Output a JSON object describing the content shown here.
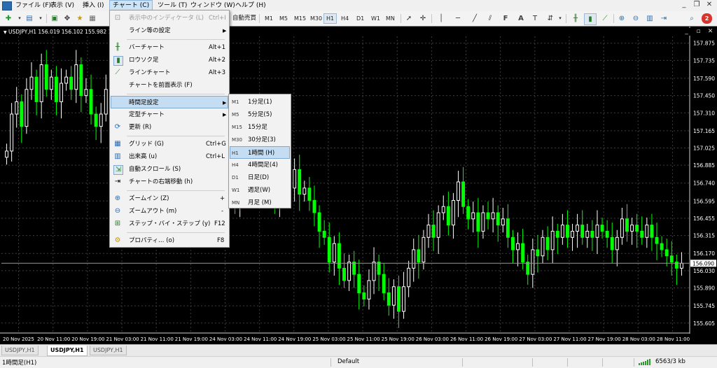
{
  "menubar": {
    "items": [
      "ファイル (F)",
      "表示 (V)",
      "挿入 (I)",
      "チャート (C)",
      "ツール (T)",
      "ウィンドウ (W)",
      "ヘルプ (H)"
    ]
  },
  "toolbar": {
    "autotrade_label": "自動売買",
    "timeframes": [
      "M1",
      "M5",
      "M15",
      "M30",
      "H1",
      "H4",
      "D1",
      "W1",
      "MN"
    ]
  },
  "chart": {
    "header": "USDJPY,H1  156.019 156.102 155.982 156.090",
    "current_price": "156.090",
    "colors": {
      "background": "#000000",
      "bull": "#ffffff",
      "bear": "#00ff00",
      "grid": "#3c3c3c"
    }
  },
  "chart_menu": {
    "items": [
      {
        "icon": "indicators-icon",
        "label": "表示中のインディケータ (L)",
        "shortcut": "Ctrl+I",
        "disabled": true
      },
      {
        "icon": "",
        "label": "ライン等の設定",
        "submenu": true
      },
      {
        "sep": true
      },
      {
        "icon": "bar-chart-icon",
        "label": "バーチャート",
        "shortcut": "Alt+1"
      },
      {
        "icon": "candlestick-icon",
        "label": "ロウソク足",
        "shortcut": "Alt+2"
      },
      {
        "icon": "line-chart-icon",
        "label": "ラインチャート",
        "shortcut": "Alt+3"
      },
      {
        "icon": "",
        "label": "チャートを前面表示 (F)"
      },
      {
        "sep": true
      },
      {
        "icon": "",
        "label": "時間足設定",
        "submenu": true,
        "highlighted": true
      },
      {
        "icon": "",
        "label": "定型チャート",
        "submenu": true
      },
      {
        "icon": "refresh-icon",
        "label": "更新 (R)"
      },
      {
        "sep": true
      },
      {
        "icon": "grid-icon",
        "label": "グリッド (G)",
        "shortcut": "Ctrl+G"
      },
      {
        "icon": "volume-icon",
        "label": "出来高 (u)",
        "shortcut": "Ctrl+L"
      },
      {
        "icon": "autoscroll-icon",
        "label": "自動スクロール (S)"
      },
      {
        "icon": "chart-shift-icon",
        "label": "チャートの右端移動 (h)"
      },
      {
        "sep": true
      },
      {
        "icon": "zoom-in-icon",
        "label": "ズームイン (Z)",
        "shortcut": "+"
      },
      {
        "icon": "zoom-out-icon",
        "label": "ズームアウト (m)",
        "shortcut": "-"
      },
      {
        "icon": "step-icon",
        "label": "ステップ・バイ・ステップ (y)",
        "shortcut": "F12"
      },
      {
        "sep": true
      },
      {
        "icon": "properties-icon",
        "label": "プロパティ… (o)",
        "shortcut": "F8"
      }
    ]
  },
  "timeframe_menu": {
    "items": [
      {
        "code": "M1",
        "label": "1分足(1)"
      },
      {
        "code": "M5",
        "label": "5分足(5)"
      },
      {
        "code": "M15",
        "label": "15分足"
      },
      {
        "code": "M30",
        "label": "30分足(3)"
      },
      {
        "code": "H1",
        "label": "1時間 (H)",
        "highlighted": true
      },
      {
        "code": "H4",
        "label": "4時間足(4)"
      },
      {
        "code": "D1",
        "label": "日足(D)"
      },
      {
        "code": "W1",
        "label": "週足(W)"
      },
      {
        "code": "MN",
        "label": "月足 (M)"
      }
    ]
  },
  "tabs": [
    "USDJPY,H1",
    "USDJPY,H1",
    "USDJPY,H1"
  ],
  "active_tab": 1,
  "status": {
    "left": "1時間足(H1)",
    "profile": "Default",
    "traffic": "6563/3 kb"
  },
  "chart_data": {
    "type": "candlestick",
    "symbol": "USDJPY",
    "timeframe": "H1",
    "x_ticks": [
      "20 Nov 2025",
      "20 Nov 11:00",
      "20 Nov 19:00",
      "21 Nov 03:00",
      "21 Nov 11:00",
      "21 Nov 19:00",
      "24 Nov 03:00",
      "24 Nov 11:00",
      "24 Nov 19:00",
      "25 Nov 03:00",
      "25 Nov 11:00",
      "25 Nov 19:00",
      "26 Nov 03:00",
      "26 Nov 11:00",
      "26 Nov 19:00",
      "27 Nov 03:00",
      "27 Nov 11:00",
      "27 Nov 19:00",
      "28 Nov 03:00",
      "28 Nov 11:00"
    ],
    "y_ticks": [
      "157.875",
      "157.735",
      "157.590",
      "157.450",
      "157.310",
      "157.165",
      "157.025",
      "156.885",
      "156.740",
      "156.595",
      "156.455",
      "156.315",
      "156.170",
      "156.030",
      "155.890",
      "155.745",
      "155.605"
    ],
    "ylim": [
      155.53,
      157.93
    ],
    "current_price": 156.09,
    "grid": true,
    "closes": [
      157.0,
      157.3,
      157.4,
      157.2,
      157.5,
      157.6,
      157.4,
      157.7,
      157.5,
      157.6,
      157.4,
      157.55,
      157.6,
      157.5,
      157.7,
      157.45,
      157.5,
      157.3,
      157.2,
      157.3,
      157.5,
      157.35,
      157.4,
      157.2,
      157.3,
      157.1,
      156.95,
      157.0,
      156.8,
      156.85,
      157.0,
      156.9,
      156.75,
      156.85,
      157.0,
      157.05,
      156.9,
      157.1,
      157.0,
      156.8,
      156.7,
      156.5,
      156.6,
      156.5,
      156.65,
      156.75,
      156.6,
      156.7,
      156.9,
      156.8,
      156.95,
      156.75,
      156.85,
      156.7,
      156.6,
      156.75,
      156.8,
      156.7,
      156.85,
      156.65,
      156.7,
      156.6,
      156.5,
      156.35,
      156.3,
      156.1,
      156.25,
      156.05,
      155.95,
      156.1,
      156.0,
      155.85,
      155.8,
      155.95,
      156.1,
      156.0,
      155.85,
      155.75,
      155.9,
      155.7,
      155.9,
      156.05,
      156.2,
      156.1,
      156.3,
      156.4,
      156.3,
      156.5,
      156.55,
      156.4,
      156.6,
      156.75,
      156.55,
      156.45,
      156.5,
      156.35,
      156.5,
      156.45,
      156.5,
      156.4,
      156.45,
      156.3,
      156.2,
      156.25,
      156.1,
      156.0,
      156.2,
      156.15,
      156.3,
      156.2,
      156.35,
      156.3,
      156.4,
      156.3,
      156.35,
      156.4,
      156.3,
      156.35,
      156.3,
      156.4,
      156.35,
      156.3,
      156.2,
      156.3,
      156.45,
      156.35,
      156.4,
      156.35,
      156.3,
      156.4,
      156.3,
      156.25,
      156.2,
      156.15,
      156.1,
      156.05,
      156.09
    ]
  }
}
